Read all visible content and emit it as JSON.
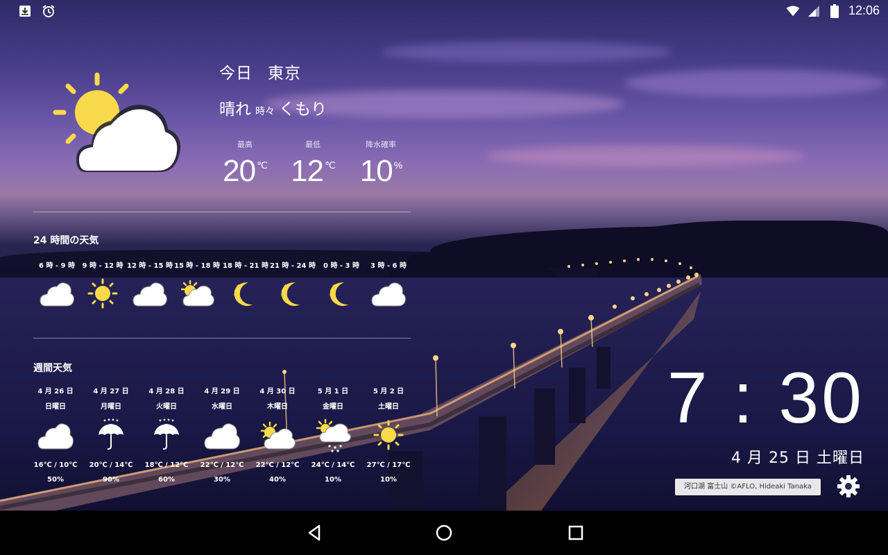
{
  "status_bar": {
    "time": "12:06",
    "left_icons": [
      "download-box-icon",
      "alarm-clock-icon"
    ],
    "right_icons": [
      "wifi-icon",
      "cell-signal-icon",
      "battery-icon"
    ]
  },
  "today": {
    "day_label": "今日",
    "city": "東京",
    "condition_main": "晴れ",
    "condition_connector": "時々",
    "condition_secondary": "くもり",
    "icon": "sun-behind-cloud-icon",
    "high_label": "最高",
    "high_value": "20",
    "high_unit": "℃",
    "low_label": "最低",
    "low_value": "12",
    "low_unit": "℃",
    "precip_label": "降水確率",
    "precip_value": "10",
    "precip_unit": "%"
  },
  "hourly": {
    "title": "24 時間の天気",
    "items": [
      {
        "label": "6 時 - 9 時",
        "icon": "cloud-icon"
      },
      {
        "label": "9 時 - 12 時",
        "icon": "sun-icon"
      },
      {
        "label": "12 時 - 15 時",
        "icon": "cloud-icon"
      },
      {
        "label": "15 時 - 18 時",
        "icon": "sun-behind-cloud-icon"
      },
      {
        "label": "18 時 - 21 時",
        "icon": "moon-icon"
      },
      {
        "label": "21 時 - 24 時",
        "icon": "moon-icon"
      },
      {
        "label": "0 時 - 3 時",
        "icon": "moon-icon"
      },
      {
        "label": "3 時 - 6 時",
        "icon": "cloud-icon"
      }
    ]
  },
  "weekly": {
    "title": "週間天気",
    "items": [
      {
        "date": "4 月 26 日",
        "dow": "日曜日",
        "icon": "cloud-icon",
        "temp": "16℃ / 10℃",
        "prob": "50%"
      },
      {
        "date": "4 月 27 日",
        "dow": "月曜日",
        "icon": "umbrella-icon",
        "temp": "20℃ / 14℃",
        "prob": "90%"
      },
      {
        "date": "4 月 28 日",
        "dow": "火曜日",
        "icon": "umbrella-icon",
        "temp": "18℃ / 12℃",
        "prob": "60%"
      },
      {
        "date": "4 月 29 日",
        "dow": "水曜日",
        "icon": "cloud-icon",
        "temp": "22℃ / 12℃",
        "prob": "30%"
      },
      {
        "date": "4 月 30 日",
        "dow": "木曜日",
        "icon": "sun-behind-cloud-icon",
        "temp": "22℃ / 12℃",
        "prob": "40%"
      },
      {
        "date": "5 月 1 日",
        "dow": "金曜日",
        "icon": "sun-cloud-rain-icon",
        "temp": "24℃ / 14℃",
        "prob": "10%"
      },
      {
        "date": "5 月 2 日",
        "dow": "土曜日",
        "icon": "sun-icon",
        "temp": "27℃ / 17℃",
        "prob": "10%"
      }
    ]
  },
  "clock": {
    "time": "7 : 30",
    "date": "4 月 25 日 土曜日"
  },
  "photo_credit": "河口湖 富士山 ©AFLO, Hideaki Tanaka",
  "settings_icon": "gear-icon",
  "nav": {
    "back_icon": "back-triangle-icon",
    "home_icon": "home-circle-icon",
    "recents_icon": "recents-square-icon"
  },
  "colors": {
    "sun": "#f8d94a",
    "cloud": "#ffffff",
    "moon": "#f8d94a",
    "umbrella": "#ffffff",
    "navbar": "#000000",
    "credit_bg": "#e8e8ea"
  }
}
